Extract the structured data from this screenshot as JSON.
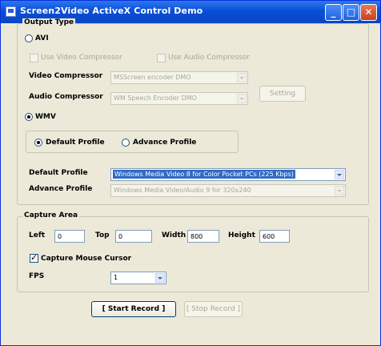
{
  "window": {
    "title": "Screen2Video ActiveX Control Demo"
  },
  "title_buttons": {
    "minimize": "_",
    "maximize": "□",
    "close": "✕"
  },
  "output_type": {
    "legend": "Output Type",
    "avi_label": "AVI",
    "use_video_compressor": "Use Video Compressor",
    "use_audio_compressor": "Use Audio Compressor",
    "video_compressor_label": "Video Compressor",
    "video_compressor_value": "MSScreen encoder DMO",
    "audio_compressor_label": "Audio Compressor",
    "audio_compressor_value": "WM Speech Encoder DMO",
    "setting_button": "Setting",
    "wmv_label": "WMV",
    "default_profile_radio": "Default Profile",
    "advance_profile_radio": "Advance Profile",
    "default_profile_label": "Default Profile",
    "default_profile_value": "Windows Media Video 8 for Color Pocket PCs (225 Kbps)",
    "advance_profile_label": "Advance Profile",
    "advance_profile_value": "Windows Media Video/Audio 9 for 320x240"
  },
  "capture_area": {
    "legend": "Capture Area",
    "left_label": "Left",
    "left_value": "0",
    "top_label": "Top",
    "top_value": "0",
    "width_label": "Width",
    "width_value": "800",
    "height_label": "Height",
    "height_value": "600",
    "capture_mouse_label": "Capture Mouse Cursor",
    "fps_label": "FPS",
    "fps_value": "1"
  },
  "actions": {
    "start_record": "[ Start Record ]",
    "stop_record": "[ Stop Record ]"
  }
}
